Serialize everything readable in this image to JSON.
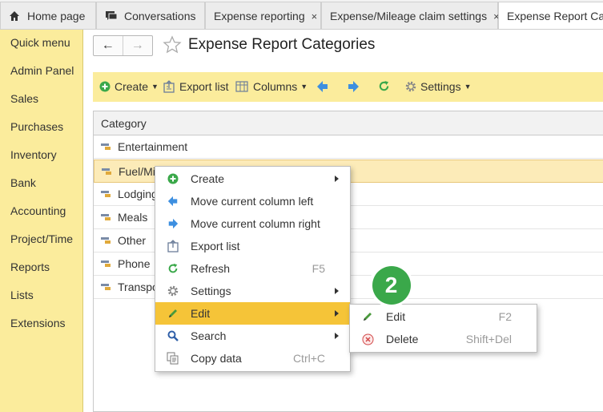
{
  "tabs": [
    {
      "label": "Home page",
      "icon": "home-icon"
    },
    {
      "label": "Conversations",
      "icon": "chat-icon"
    },
    {
      "label": "Expense reporting",
      "close": "×"
    },
    {
      "label": "Expense/Mileage claim settings",
      "close": "×"
    },
    {
      "label": "Expense Report Cat",
      "active": true
    }
  ],
  "sidebar": {
    "items": [
      {
        "label": "Quick menu"
      },
      {
        "label": "Admin Panel"
      },
      {
        "label": "Sales"
      },
      {
        "label": "Purchases"
      },
      {
        "label": "Inventory"
      },
      {
        "label": "Bank"
      },
      {
        "label": "Accounting"
      },
      {
        "label": "Project/Time"
      },
      {
        "label": "Reports"
      },
      {
        "label": "Lists"
      },
      {
        "label": "Extensions"
      }
    ]
  },
  "header": {
    "title": "Expense Report Categories",
    "back": "←",
    "forward": "→"
  },
  "toolbar": {
    "create": "Create",
    "export": "Export list",
    "columns": "Columns",
    "settings": "Settings"
  },
  "table": {
    "header": "Category",
    "rows": [
      {
        "label": "Entertainment"
      },
      {
        "label": "Fuel/Mil",
        "selected": true
      },
      {
        "label": "Lodging"
      },
      {
        "label": "Meals"
      },
      {
        "label": "Other"
      },
      {
        "label": "Phone"
      },
      {
        "label": "Transpo"
      }
    ]
  },
  "context_menu": {
    "items": [
      {
        "label": "Create",
        "icon": "plus-circle-icon",
        "submenu": true
      },
      {
        "label": "Move current column left",
        "icon": "arrow-left-icon"
      },
      {
        "label": "Move current column right",
        "icon": "arrow-right-icon"
      },
      {
        "label": "Export list",
        "icon": "export-icon"
      },
      {
        "label": "Refresh",
        "icon": "refresh-icon",
        "shortcut": "F5"
      },
      {
        "label": "Settings",
        "icon": "gear-icon",
        "submenu": true
      },
      {
        "label": "Edit",
        "icon": "pencil-icon",
        "submenu": true,
        "highlighted": true
      },
      {
        "label": "Search",
        "icon": "search-icon",
        "submenu": true
      },
      {
        "label": "Copy data",
        "icon": "copy-icon",
        "shortcut": "Ctrl+C"
      }
    ]
  },
  "edit_submenu": {
    "items": [
      {
        "label": "Edit",
        "icon": "pencil-icon",
        "shortcut": "F2"
      },
      {
        "label": "Delete",
        "icon": "delete-icon",
        "shortcut": "Shift+Del"
      }
    ]
  },
  "step_badge": "2",
  "colors": {
    "sidebar_bg": "#fbec9c",
    "toolbar_bg": "#fbec9c",
    "highlight": "#f5c438",
    "selected_row": "#fcebb8",
    "accent_green": "#3aa84a",
    "arrow_blue": "#3d8fe0"
  }
}
